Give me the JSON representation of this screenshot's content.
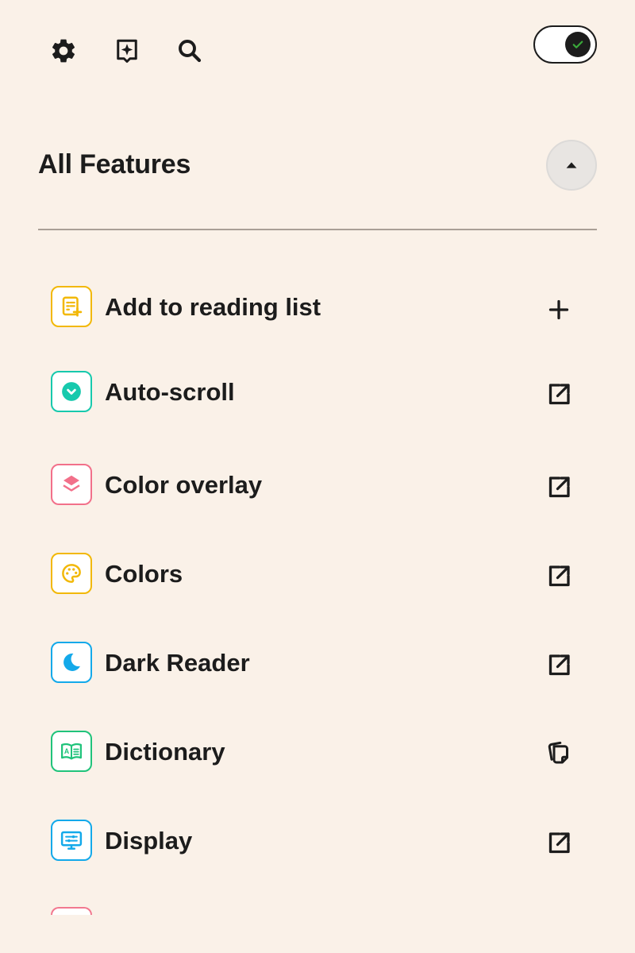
{
  "header": {
    "toggle": {
      "state": "on",
      "accent": "#3aa83a"
    }
  },
  "section": {
    "title": "All Features",
    "collapse_icon": "caret-up-icon"
  },
  "features": [
    {
      "label": "Add to reading list",
      "icon": "reading-list-add-icon",
      "color": "#f2b807",
      "action": "plus-icon"
    },
    {
      "label": "Auto-scroll",
      "icon": "chevron-down-circle-icon",
      "color": "#17c9ad",
      "action": "open-external-icon"
    },
    {
      "label": "Color overlay",
      "icon": "layers-icon",
      "color": "#f2708a",
      "action": "open-external-icon"
    },
    {
      "label": "Colors",
      "icon": "palette-icon",
      "color": "#f2b807",
      "action": "open-external-icon"
    },
    {
      "label": "Dark Reader",
      "icon": "moon-icon",
      "color": "#13a9ea",
      "action": "open-external-icon"
    },
    {
      "label": "Dictionary",
      "icon": "dictionary-book-icon",
      "color": "#20c37b",
      "action": "copy-pages-icon"
    },
    {
      "label": "Display",
      "icon": "display-settings-icon",
      "color": "#13a9ea",
      "action": "open-external-icon"
    }
  ]
}
